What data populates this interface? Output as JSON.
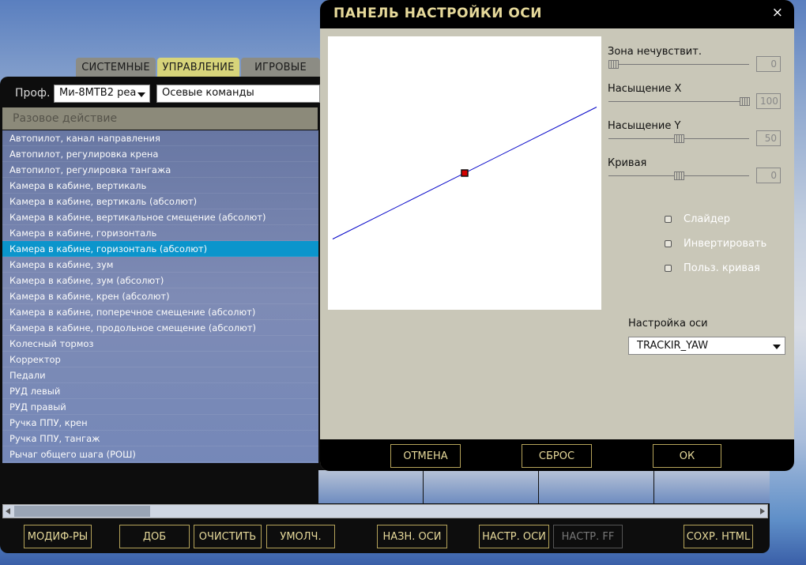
{
  "tabs": [
    {
      "label": "СИСТЕМНЫЕ"
    },
    {
      "label": "УПРАВЛЕНИЕ"
    },
    {
      "label": "ИГРОВЫЕ"
    }
  ],
  "profile": {
    "label": "Проф.",
    "value": "Ми-8МТВ2 реа",
    "category": "Осевые команды"
  },
  "list": {
    "header": "Разовое действие",
    "selected_index": 7,
    "items": [
      "Автопилот, канал направления",
      "Автопилот, регулировка крена",
      "Автопилот, регулировка тангажа",
      "Камера в кабине, вертикаль",
      "Камера в кабине, вертикаль (абсолют)",
      "Камера в кабине, вертикальное смещение (абсолют)",
      "Камера в кабине, горизонталь",
      "Камера в кабине, горизонталь (абсолют)",
      "Камера в кабине, зум",
      "Камера в кабине, зум (абсолют)",
      "Камера в кабине, крен (абсолют)",
      "Камера в кабине, поперечное смещение (абсолют)",
      "Камера в кабине, продольное смещение (абсолют)",
      "Колесный тормоз",
      "Корректор",
      "Педали",
      "РУД левый",
      "РУД правый",
      "Ручка ППУ, крен",
      "Ручка ППУ, тангаж",
      "Рычаг общего шага (РОШ)"
    ]
  },
  "toolbar": {
    "modifiers": "МОДИФ-РЫ",
    "add": "ДОБ",
    "clear": "ОЧИСТИТЬ",
    "default": "УМОЛЧ.",
    "assign_axis": "НАЗН. ОСИ",
    "tune_axis": "НАСТР. ОСИ",
    "tune_ff": "НАСТР. FF",
    "save_html": "СОХР. HTML"
  },
  "dialog": {
    "title": "ПАНЕЛЬ НАСТРОЙКИ ОСИ",
    "close": "×",
    "sliders": [
      {
        "label": "Зона нечувствит.",
        "value": "0",
        "level": 0
      },
      {
        "label": "Насыщение X",
        "value": "100",
        "level": 1
      },
      {
        "label": "Насыщение Y",
        "value": "50",
        "level": 0.5
      },
      {
        "label": "Кривая",
        "value": "0",
        "level": 0.5
      }
    ],
    "checkboxes": [
      {
        "label": "Слайдер",
        "checked": false
      },
      {
        "label": "Инвертировать",
        "checked": false
      },
      {
        "label": "Польз. кривая",
        "checked": false
      }
    ],
    "axis_setting": {
      "label": "Настройка оси",
      "value": "TRACKIR_YAW"
    },
    "buttons": {
      "cancel": "ОТМЕНА",
      "reset": "СБРОС",
      "ok": "ОК"
    },
    "curve": {
      "left_output": -0.5,
      "right_output": 0.5,
      "current_input": 0,
      "current_output": 0
    }
  }
}
